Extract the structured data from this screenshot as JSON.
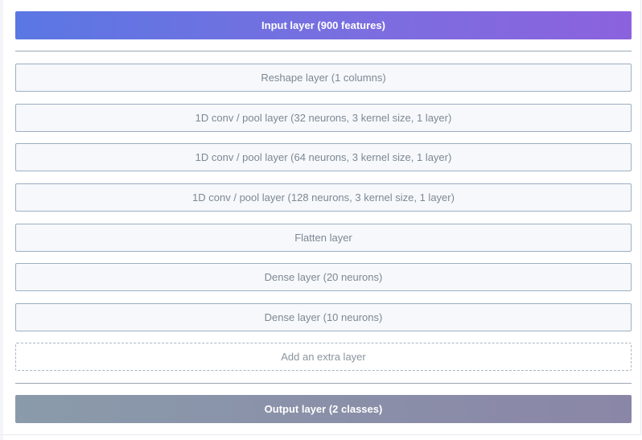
{
  "input_layer": {
    "label": "Input layer (900 features)"
  },
  "layers": [
    {
      "label": "Reshape layer (1 columns)"
    },
    {
      "label": "1D conv / pool layer (32 neurons, 3 kernel size, 1 layer)"
    },
    {
      "label": "1D conv / pool layer (64 neurons, 3 kernel size, 1 layer)"
    },
    {
      "label": "1D conv / pool layer (128 neurons, 3 kernel size, 1 layer)"
    },
    {
      "label": "Flatten layer"
    },
    {
      "label": "Dense layer (20 neurons)"
    },
    {
      "label": "Dense layer (10 neurons)"
    }
  ],
  "add_layer": {
    "label": "Add an extra layer"
  },
  "output_layer": {
    "label": "Output layer (2 classes)"
  },
  "colors": {
    "input_gradient_start": "#5a77e3",
    "input_gradient_end": "#8b62de",
    "output_gradient_start": "#8a9bab",
    "output_gradient_end": "#8a86a7",
    "layer_border": "#9cafc2",
    "layer_text": "#7d8894"
  }
}
